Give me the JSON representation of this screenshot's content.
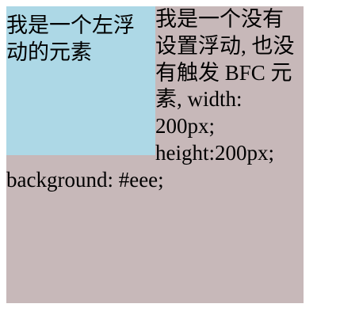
{
  "float_box": {
    "text": "我是一个左浮动的元素",
    "bg": "#add8e6"
  },
  "nobfc_box": {
    "text": "我是一个没有设置浮动, 也没有触发 BFC 元素, width: 200px; height:200px; background: #eee;",
    "bg": "#c7b8b9"
  }
}
